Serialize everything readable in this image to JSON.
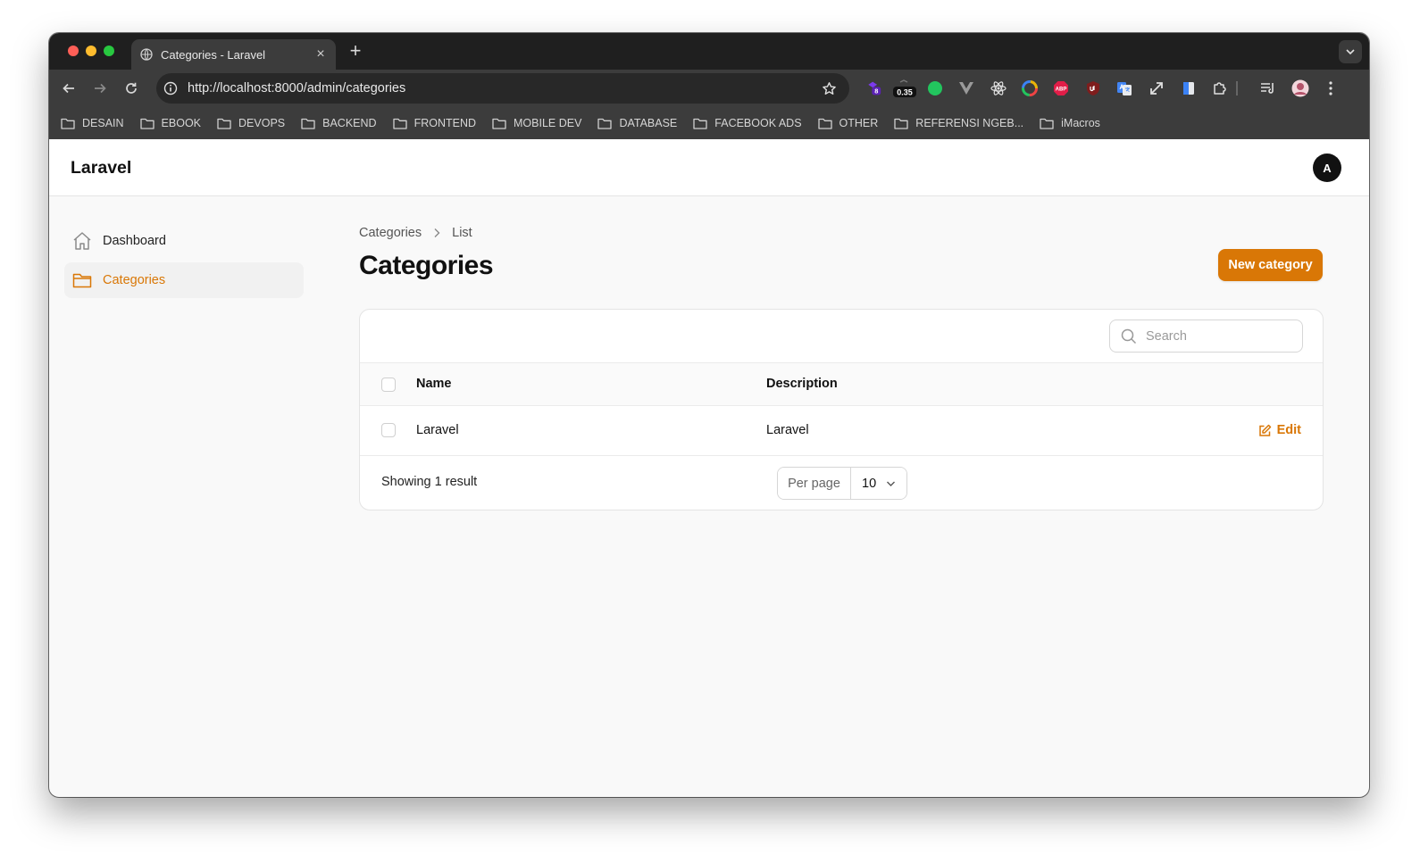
{
  "browser": {
    "tab_title": "Categories - Laravel",
    "url": "http://localhost:8000/admin/categories",
    "extension_badges": {
      "badge_1": "8",
      "badge_2": "0.35",
      "abp": "ABP"
    },
    "bookmarks": [
      "DESAIN",
      "EBOOK",
      "DEVOPS",
      "BACKEND",
      "FRONTEND",
      "MOBILE DEV",
      "DATABASE",
      "FACEBOOK ADS",
      "OTHER",
      "REFERENSI NGEB...",
      "iMacros"
    ]
  },
  "app": {
    "brand": "Laravel",
    "avatar_initial": "A",
    "accent_color": "#d97706"
  },
  "sidebar": {
    "items": [
      {
        "label": "Dashboard",
        "icon": "home-icon"
      },
      {
        "label": "Categories",
        "icon": "folder-icon",
        "active": true
      }
    ]
  },
  "main": {
    "breadcrumb": [
      "Categories",
      "List"
    ],
    "title": "Categories",
    "new_button": "New category",
    "search_placeholder": "Search",
    "table": {
      "columns": [
        "Name",
        "Description"
      ],
      "rows": [
        {
          "name": "Laravel",
          "description": "Laravel",
          "action": "Edit"
        }
      ]
    },
    "footer": {
      "showing": "Showing 1 result",
      "per_page_label": "Per page",
      "per_page_value": "10"
    }
  }
}
